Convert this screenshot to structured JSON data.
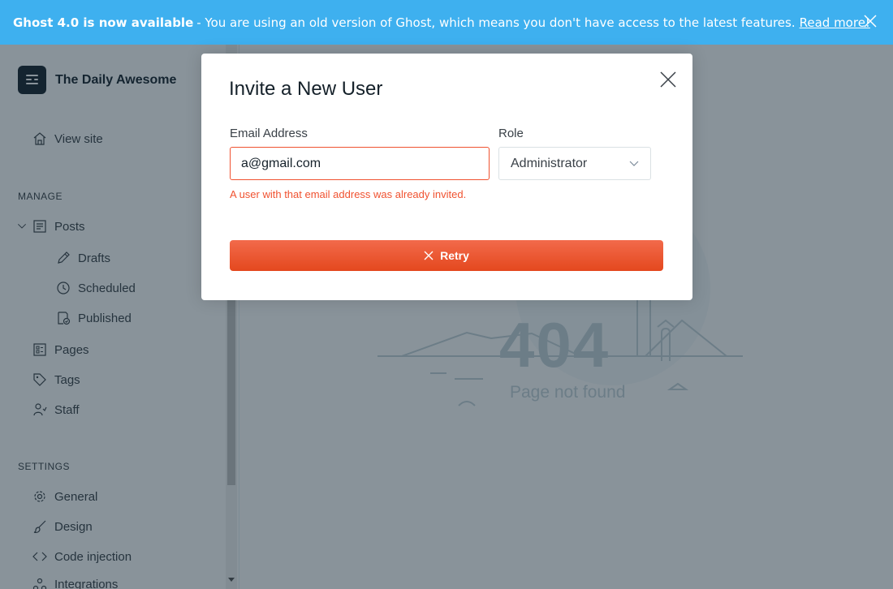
{
  "banner": {
    "strong": "Ghost 4.0 is now available",
    "message": "- You are using an old version of Ghost, which means you don't have access to the latest features.",
    "link": "Read more!"
  },
  "sidebar": {
    "brand": "The Daily Awesome",
    "view_site": "View site",
    "manage_label": "MANAGE",
    "posts": "Posts",
    "drafts": "Drafts",
    "scheduled": "Scheduled",
    "published": "Published",
    "pages": "Pages",
    "tags": "Tags",
    "staff": "Staff",
    "settings_label": "SETTINGS",
    "general": "General",
    "design": "Design",
    "code_injection": "Code injection",
    "integrations": "Integrations"
  },
  "main": {
    "code": "404",
    "message": "Page not found"
  },
  "modal": {
    "title": "Invite a New User",
    "email_label": "Email Address",
    "email_value": "a@gmail.com",
    "role_label": "Role",
    "role_value": "Administrator",
    "error": "A user with that email address was already invited.",
    "retry_label": "Retry"
  },
  "colors": {
    "banner": "#3eb0ef",
    "error": "#f05230",
    "button": "#e4481e"
  }
}
